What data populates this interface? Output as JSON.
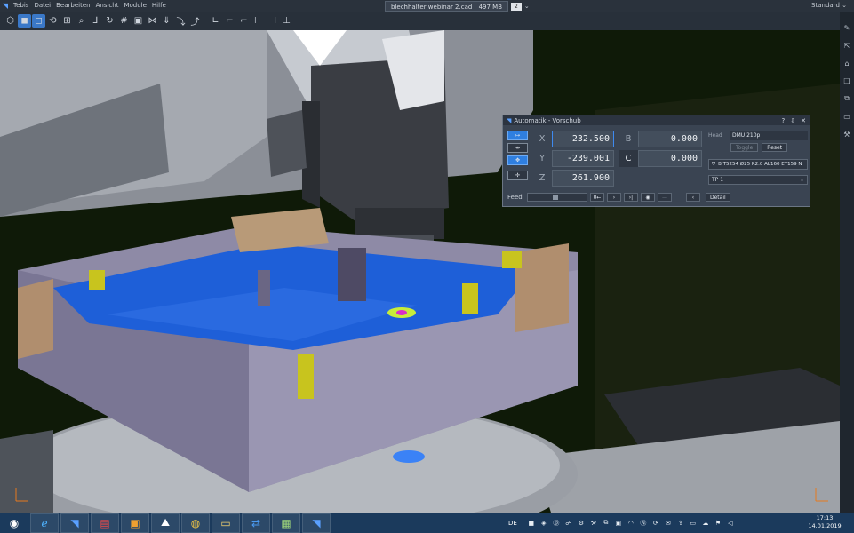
{
  "menubar": {
    "menus": [
      "Tebis",
      "Datei",
      "Bearbeiten",
      "Ansicht",
      "Module",
      "Hilfe"
    ],
    "document": "blechhalter webinar 2.cad",
    "memory": "497 MB",
    "doc_count": "2",
    "mode": "Standard"
  },
  "toolbar": {
    "icons": [
      "cube-wire-icon",
      "cube-shaded-icon",
      "cube-transparent-icon",
      "rotate-icon",
      "zoom-window-icon",
      "zoom-icon",
      "axis-icon",
      "refresh-icon",
      "grid-icon",
      "frame-icon",
      "view-iso-icon",
      "view-front-icon",
      "view-right-icon",
      "view-top-icon",
      "coord-x-icon",
      "coord-y-icon",
      "coord-z-icon",
      "coord-xy-icon",
      "coord-yz-icon",
      "coord-xz-icon"
    ]
  },
  "panel": {
    "title": "Automatik - Vorschub",
    "controls": [
      "?",
      "⇩",
      "✕"
    ],
    "axes": {
      "x_label": "X",
      "x_value": "232.500",
      "y_label": "Y",
      "y_value": "-239.001",
      "z_label": "Z",
      "z_value": "261.900",
      "b_label": "B",
      "b_value": "0.000",
      "c_label": "C",
      "c_value": "0.000"
    },
    "head_label": "Head",
    "head_value": "DMU 210p",
    "toggle_label": "Toggle",
    "reset_label": "Reset",
    "tool": "B T5254 Ø25 R2.0 AL160 ET159 N",
    "toolpath": "TP 1",
    "feed_label": "Feed",
    "detail_label": "Detail"
  },
  "taskbar": {
    "language": "DE",
    "time": "17:13",
    "date": "14.01.2019"
  },
  "colors": {
    "accent": "#2f7fe0",
    "background": "#0f1a08",
    "part_blue": "#1e5fd8",
    "part_gray": "#8e8aa6",
    "part_yellow": "#c8c41e"
  }
}
